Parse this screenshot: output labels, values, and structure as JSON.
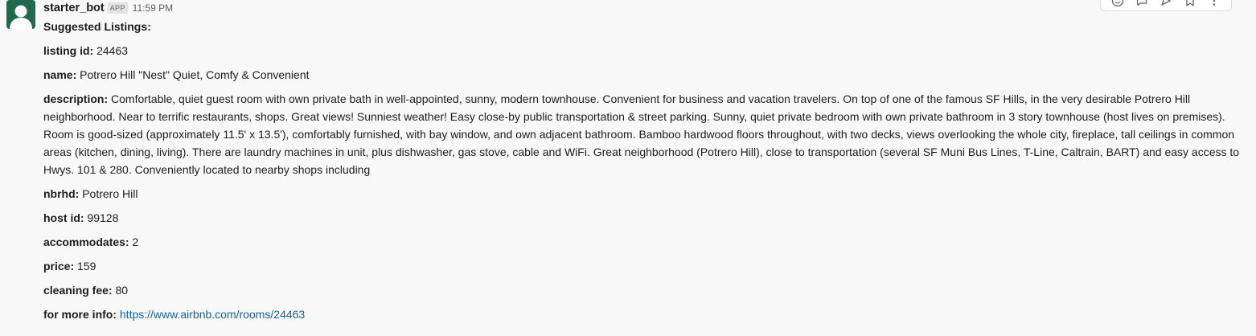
{
  "message": {
    "username": "starter_bot",
    "badge": "APP",
    "timestamp": "11:59 PM",
    "title": "Suggested Listings:",
    "fields": [
      {
        "label": "listing id:",
        "value": "24463"
      },
      {
        "label": "name:",
        "value": "Potrero Hill \"Nest\" Quiet, Comfy & Convenient"
      },
      {
        "label": "description:",
        "value": "Comfortable, quiet guest room with own private bath in well-appointed, sunny, modern townhouse. Convenient for business and vacation travelers. On top of one of the famous SF Hills, in the very desirable Potrero Hill neighborhood.  Near to terrific restaurants, shops. Great views! Sunniest weather! Easy close-by public transportation & street parking. Sunny, quiet private bedroom with own private bathroom in 3 story townhouse (host lives on premises). Room is good-sized (approximately 11.5' x 13.5'), comfortably furnished, with bay window, and own adjacent bathroom. Bamboo hardwood floors throughout, with two decks, views overlooking the whole city, fireplace, tall ceilings in common areas (kitchen, dining, living). There are laundry machines in unit, plus dishwasher, gas stove, cable and WiFi.  Great neighborhood (Potrero Hill), close to transportation (several SF Muni Bus Lines, T-Line, Caltrain, BART) and easy access to Hwys. 101 & 280. Conveniently located to nearby shops including"
      },
      {
        "label": "nbrhd:",
        "value": "Potrero Hill"
      },
      {
        "label": "host id:",
        "value": "99128"
      },
      {
        "label": "accommodates:",
        "value": "2"
      },
      {
        "label": "price:",
        "value": "159"
      },
      {
        "label": "cleaning fee:",
        "value": "80"
      }
    ],
    "more_info": {
      "label": "for more info:",
      "link": "https://www.airbnb.com/rooms/24463"
    }
  },
  "actions": [
    "add-reaction-icon",
    "reply-in-thread-icon",
    "share-icon",
    "bookmark-icon",
    "more-actions-icon"
  ],
  "colors": {
    "background": "#f8f8f8",
    "avatar": "#1f6a4c",
    "link": "#1264a3",
    "text": "#1d1c1d"
  }
}
